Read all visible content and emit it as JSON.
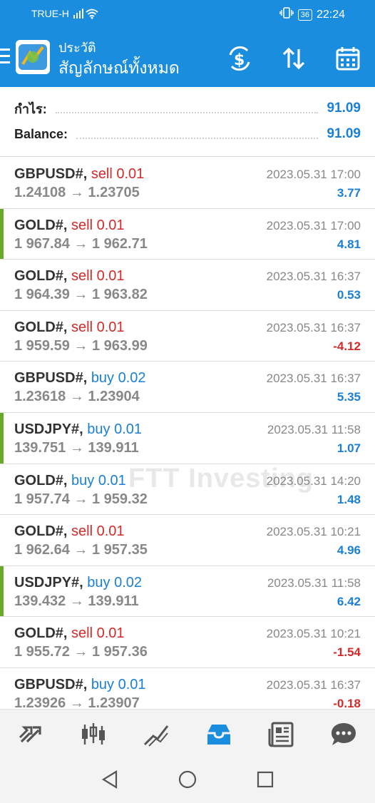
{
  "status": {
    "carrier": "TRUE-H",
    "battery": "36",
    "time": "22:24"
  },
  "header": {
    "title": "ประวัติ",
    "subtitle": "สัญลักษณ์ทั้งหมด"
  },
  "summary": {
    "profit_label": "กำไร:",
    "profit_value": "91.09",
    "balance_label": "Balance:",
    "balance_value": "91.09"
  },
  "watermark": "FTT Investing",
  "colors": {
    "accent": "#1a8ddf",
    "sell": "#d42a2a",
    "buy": "#1a7fd6",
    "positive": "#1a7fd6",
    "negative": "#d42a2a",
    "indicator": "#6aa829"
  },
  "trades": [
    {
      "symbol": "GBPUSD#,",
      "side": "sell",
      "volume": "0.01",
      "price": "1.24108 → 1.23705",
      "time": "2023.05.31 17:00",
      "profit": "3.77",
      "neg": false,
      "indicator": false
    },
    {
      "symbol": "GOLD#,",
      "side": "sell",
      "volume": "0.01",
      "price": "1 967.84 → 1 962.71",
      "time": "2023.05.31 17:00",
      "profit": "4.81",
      "neg": false,
      "indicator": true
    },
    {
      "symbol": "GOLD#,",
      "side": "sell",
      "volume": "0.01",
      "price": "1 964.39 → 1 963.82",
      "time": "2023.05.31 16:37",
      "profit": "0.53",
      "neg": false,
      "indicator": false
    },
    {
      "symbol": "GOLD#,",
      "side": "sell",
      "volume": "0.01",
      "price": "1 959.59 → 1 963.99",
      "time": "2023.05.31 16:37",
      "profit": "-4.12",
      "neg": true,
      "indicator": false
    },
    {
      "symbol": "GBPUSD#,",
      "side": "buy",
      "volume": "0.02",
      "price": "1.23618 → 1.23904",
      "time": "2023.05.31 16:37",
      "profit": "5.35",
      "neg": false,
      "indicator": false
    },
    {
      "symbol": "USDJPY#,",
      "side": "buy",
      "volume": "0.01",
      "price": "139.751 → 139.911",
      "time": "2023.05.31 11:58",
      "profit": "1.07",
      "neg": false,
      "indicator": true
    },
    {
      "symbol": "GOLD#,",
      "side": "buy",
      "volume": "0.01",
      "price": "1 957.74 → 1 959.32",
      "time": "2023.05.31 14:20",
      "profit": "1.48",
      "neg": false,
      "indicator": false
    },
    {
      "symbol": "GOLD#,",
      "side": "sell",
      "volume": "0.01",
      "price": "1 962.64 → 1 957.35",
      "time": "2023.05.31 10:21",
      "profit": "4.96",
      "neg": false,
      "indicator": false
    },
    {
      "symbol": "USDJPY#,",
      "side": "buy",
      "volume": "0.02",
      "price": "139.432 → 139.911",
      "time": "2023.05.31 11:58",
      "profit": "6.42",
      "neg": false,
      "indicator": true
    },
    {
      "symbol": "GOLD#,",
      "side": "sell",
      "volume": "0.01",
      "price": "1 955.72 → 1 957.36",
      "time": "2023.05.31 10:21",
      "profit": "-1.54",
      "neg": true,
      "indicator": false
    },
    {
      "symbol": "GBPUSD#,",
      "side": "buy",
      "volume": "0.01",
      "price": "1.23926 → 1.23907",
      "time": "2023.05.31 16:37",
      "profit": "-0.18",
      "neg": true,
      "indicator": false
    }
  ],
  "nav_icons": [
    "trade-icon",
    "chart-icon",
    "trend-icon",
    "history-icon",
    "news-icon",
    "chat-icon"
  ],
  "active_nav": 3
}
